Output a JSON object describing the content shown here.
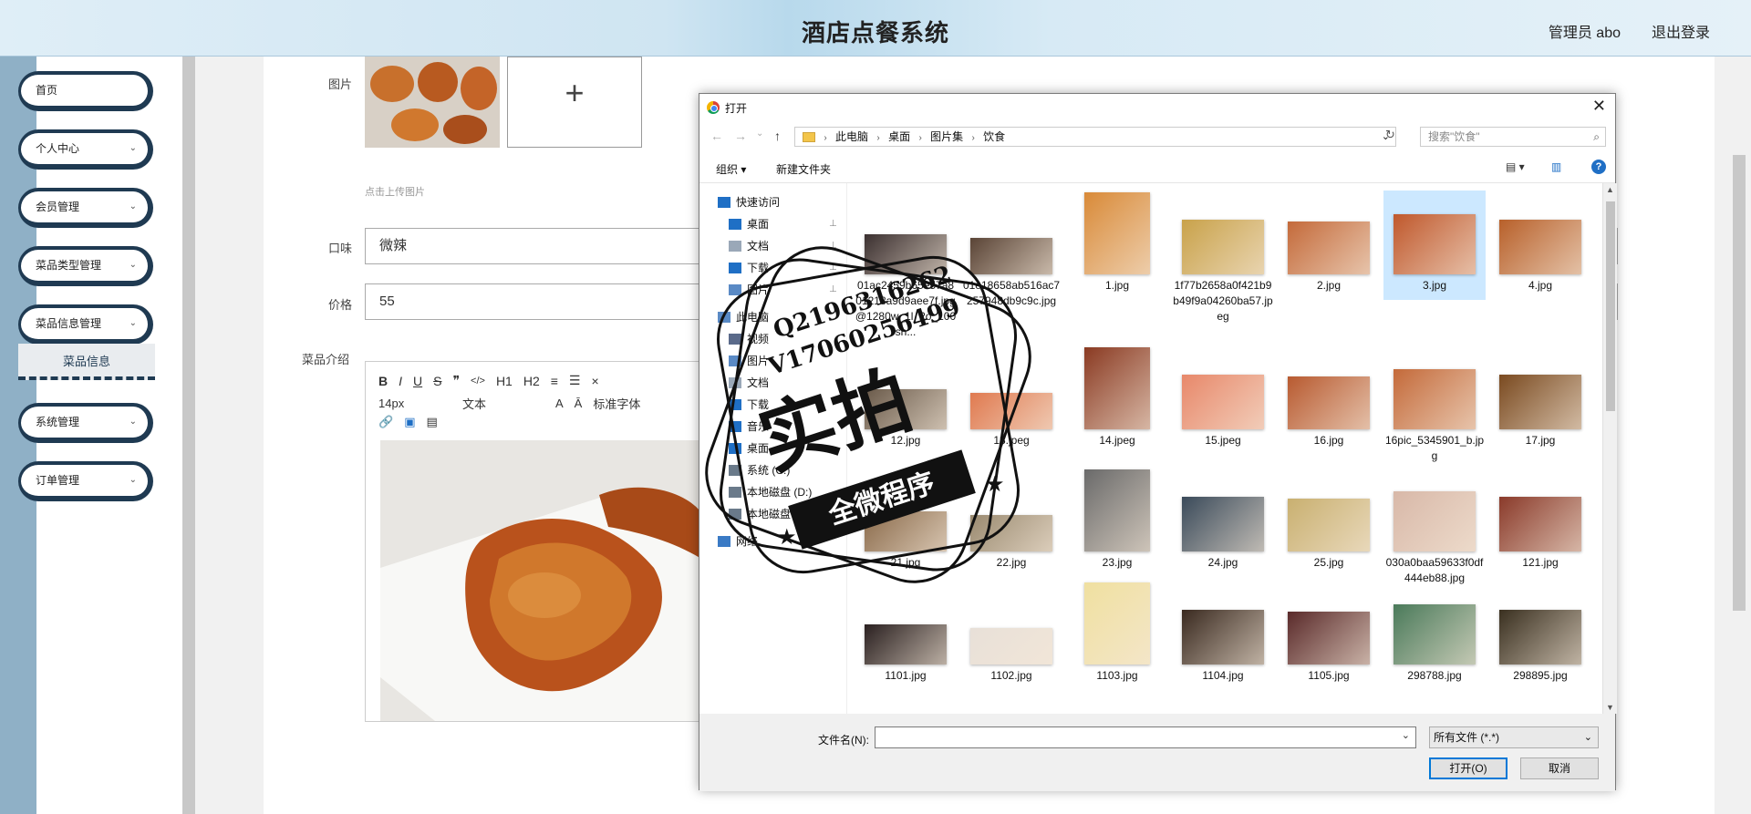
{
  "header": {
    "title": "酒店点餐系统",
    "admin_label": "管理员 abo",
    "logout_label": "退出登录"
  },
  "sidebar": {
    "items": [
      {
        "label": "首页",
        "has_chevron": false
      },
      {
        "label": "个人中心",
        "has_chevron": true
      },
      {
        "label": "会员管理",
        "has_chevron": true
      },
      {
        "label": "菜品类型管理",
        "has_chevron": true
      },
      {
        "label": "菜品信息管理",
        "has_chevron": true
      },
      {
        "label": "系统管理",
        "has_chevron": true
      },
      {
        "label": "订单管理",
        "has_chevron": true
      }
    ],
    "sub_item": "菜品信息",
    "chevron_glyph": "⌄"
  },
  "form": {
    "image_label": "图片",
    "upload_plus": "+",
    "upload_hint": "点击上传图片",
    "taste_label": "口味",
    "taste_value": "微辣",
    "price_label": "价格",
    "price_value": "55",
    "intro_label": "菜品介绍",
    "editor": {
      "toolbar1": [
        "B",
        "I",
        "U",
        "S",
        "❞",
        "</>",
        "H1",
        "H2",
        "≡",
        "☰",
        "×"
      ],
      "font_size": "14px",
      "block_type": "文本",
      "font_family": "标准字体",
      "toolbar2_icons": [
        "link-icon",
        "image-icon",
        "video-icon"
      ]
    }
  },
  "dialog": {
    "title": "打开",
    "close": "✕",
    "nav": {
      "back": "←",
      "forward": "→",
      "recent": "⌄",
      "up": "↑"
    },
    "breadcrumb": [
      "此电脑",
      "桌面",
      "图片集",
      "饮食"
    ],
    "crumb_sep": "›",
    "addr_dropdown": "⌄",
    "refresh": "↻",
    "search_placeholder": "搜索\"饮食\"",
    "search_glyph": "⌕",
    "organize": "组织 ▾",
    "new_folder": "新建文件夹",
    "view_icons": [
      "▤ ▾",
      "▥"
    ],
    "help": "?",
    "nav_pane": [
      {
        "label": "快速访问",
        "icon": "star-icon",
        "pinned": false
      },
      {
        "label": "桌面",
        "icon": "desktop-icon",
        "pinned": true
      },
      {
        "label": "文档",
        "icon": "document-icon",
        "pinned": true
      },
      {
        "label": "下载",
        "icon": "download-icon",
        "pinned": true
      },
      {
        "label": "图片",
        "icon": "picture-icon",
        "pinned": true
      },
      {
        "label": "此电脑",
        "icon": "computer-icon",
        "pinned": false
      },
      {
        "label": "视频",
        "icon": "video-icon",
        "pinned": false
      },
      {
        "label": "图片",
        "icon": "picture-icon",
        "pinned": false
      },
      {
        "label": "文档",
        "icon": "document-icon",
        "pinned": false
      },
      {
        "label": "下载",
        "icon": "download-icon",
        "pinned": false
      },
      {
        "label": "音乐",
        "icon": "music-icon",
        "pinned": false
      },
      {
        "label": "桌面",
        "icon": "desktop-icon",
        "pinned": false
      },
      {
        "label": "系统 (C:)",
        "icon": "drive-icon",
        "pinned": false
      },
      {
        "label": "本地磁盘 (D:)",
        "icon": "drive-icon",
        "pinned": false
      },
      {
        "label": "本地磁盘 (E:)",
        "icon": "drive-icon",
        "pinned": false
      },
      {
        "label": "网络",
        "icon": "network-icon",
        "pinned": false
      }
    ],
    "pin_glyph": "📌",
    "files": [
      {
        "name": "01ac2459b65e57a801218a9d9aee7f.jpg@1280w_1l_2o_100sh...",
        "color": "#3b3030",
        "selected": false
      },
      {
        "name": "01e18658ab516ac7257948db9c9c.jpg",
        "color": "#5a4436",
        "selected": false
      },
      {
        "name": "1.jpg",
        "color": "#d98a38",
        "selected": false
      },
      {
        "name": "1f77b2658a0f421b9b49f9a04260ba57.jpeg",
        "color": "#c9a24a",
        "selected": false
      },
      {
        "name": "2.jpg",
        "color": "#c46a3a",
        "selected": false
      },
      {
        "name": "3.jpg",
        "color": "#c0582c",
        "selected": true
      },
      {
        "name": "4.jpg",
        "color": "#b8602a",
        "selected": false
      },
      {
        "name": "12.jpg",
        "color": "#6a5a4a",
        "selected": false
      },
      {
        "name": "13.jpeg",
        "color": "#e07a50",
        "selected": false
      },
      {
        "name": "14.jpeg",
        "color": "#8a3a22",
        "selected": false
      },
      {
        "name": "15.jpeg",
        "color": "#e8886a",
        "selected": false
      },
      {
        "name": "16.jpg",
        "color": "#b85a30",
        "selected": false
      },
      {
        "name": "16pic_5345901_b.jpg",
        "color": "#c46a3a",
        "selected": false
      },
      {
        "name": "17.jpg",
        "color": "#7a4a20",
        "selected": false
      },
      {
        "name": "21.jpg",
        "color": "#8a6a4a",
        "selected": false
      },
      {
        "name": "22.jpg",
        "color": "#9a8a70",
        "selected": false
      },
      {
        "name": "23.jpg",
        "color": "#6a6a6a",
        "selected": false
      },
      {
        "name": "24.jpg",
        "color": "#3a4a5a",
        "selected": false
      },
      {
        "name": "25.jpg",
        "color": "#c9b070",
        "selected": false
      },
      {
        "name": "030a0baa59633f0df444eb88.jpg",
        "color": "#d8b8a8",
        "selected": false
      },
      {
        "name": "121.jpg",
        "color": "#8a3a2a",
        "selected": false
      },
      {
        "name": "1101.jpg",
        "color": "#2a2020",
        "selected": false
      },
      {
        "name": "1102.jpg",
        "color": "#e8e0d8",
        "selected": false
      },
      {
        "name": "1103.jpg",
        "color": "#f0e0a0",
        "selected": false
      },
      {
        "name": "1104.jpg",
        "color": "#3a2a20",
        "selected": false
      },
      {
        "name": "1105.jpg",
        "color": "#5a2a2a",
        "selected": false
      },
      {
        "name": "298788.jpg",
        "color": "#4a7a5a",
        "selected": false
      },
      {
        "name": "298895.jpg",
        "color": "#3a3020",
        "selected": false
      }
    ],
    "filename_label": "文件名(N):",
    "filename_value": "",
    "filename_dd": "⌄",
    "filetype": "所有文件 (*.*)",
    "filetype_dd": "⌄",
    "open_button": "打开(O)",
    "cancel_button": "取消",
    "scroll_up": "▲",
    "scroll_down": "▼"
  },
  "watermark": {
    "line1": "Q2196316262",
    "line2": "V1706025649​9",
    "big": "实拍",
    "ribbon": "全微程序",
    "star": "★"
  }
}
